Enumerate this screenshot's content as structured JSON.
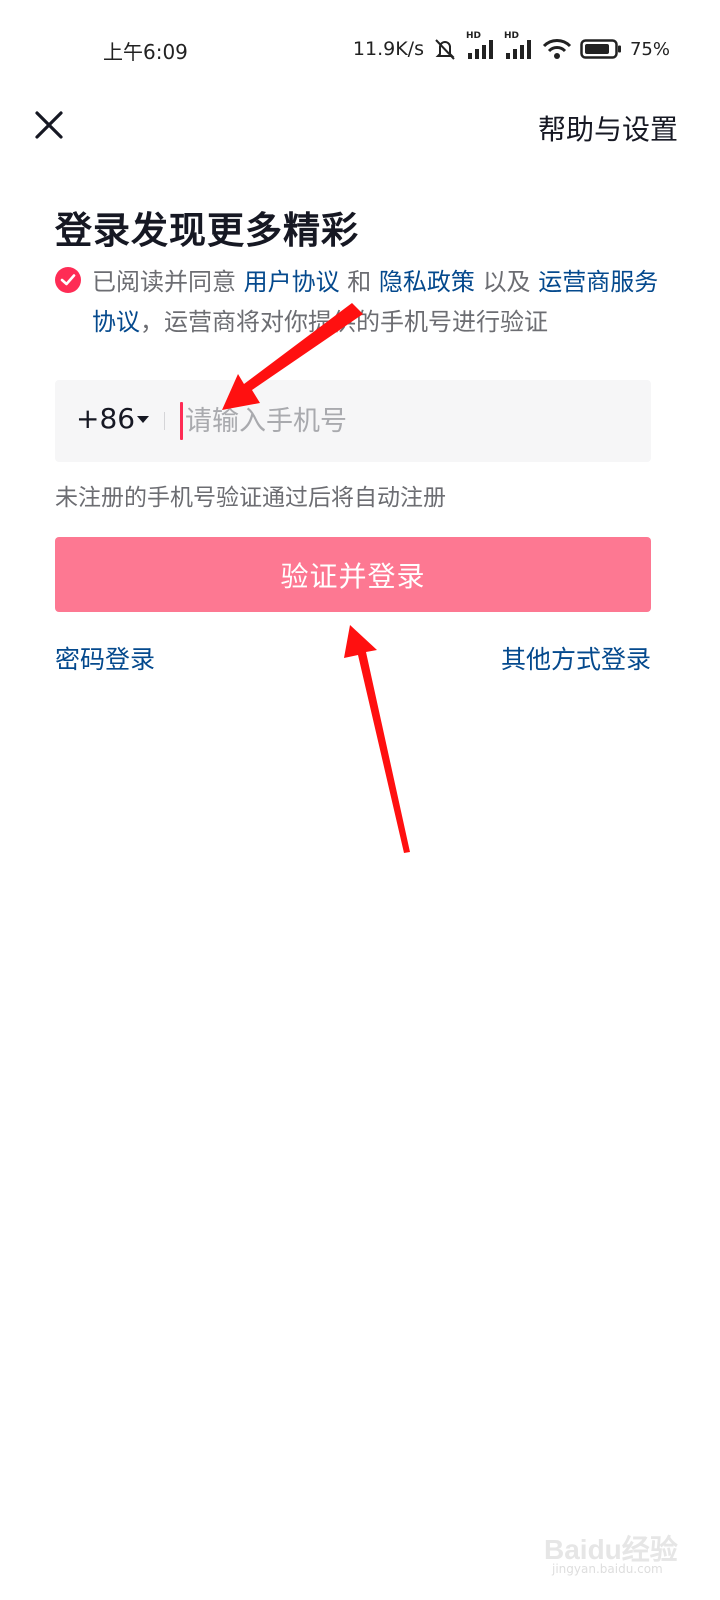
{
  "status_bar": {
    "time": "上午6:09",
    "net_speed": "11.9K/s",
    "hd1": "HD",
    "hd2": "HD",
    "battery": "75%"
  },
  "top_bar": {
    "help_label": "帮助与设置"
  },
  "title": "登录发现更多精彩",
  "agreement": {
    "checked": true,
    "prefix": "已阅读并同意",
    "user_agreement": "用户协议",
    "and": "和",
    "privacy_policy": "隐私政策",
    "also": "以及",
    "carrier_agreement": "运营商服务协议",
    "suffix": "，运营商将对你提供的手机号进行验证"
  },
  "phone": {
    "country_code": "+86",
    "placeholder": "请输入手机号",
    "value": ""
  },
  "hint": "未注册的手机号验证通过后将自动注册",
  "login_button": "验证并登录",
  "password_login": "密码登录",
  "other_login": "其他方式登录",
  "watermark": {
    "text": "Baidu经验",
    "sub": "jingyan.baidu.com"
  },
  "colors": {
    "accent": "#fe2c55",
    "button": "#fd7892",
    "link": "#04498d",
    "annotation_arrow": "#ff0000"
  }
}
